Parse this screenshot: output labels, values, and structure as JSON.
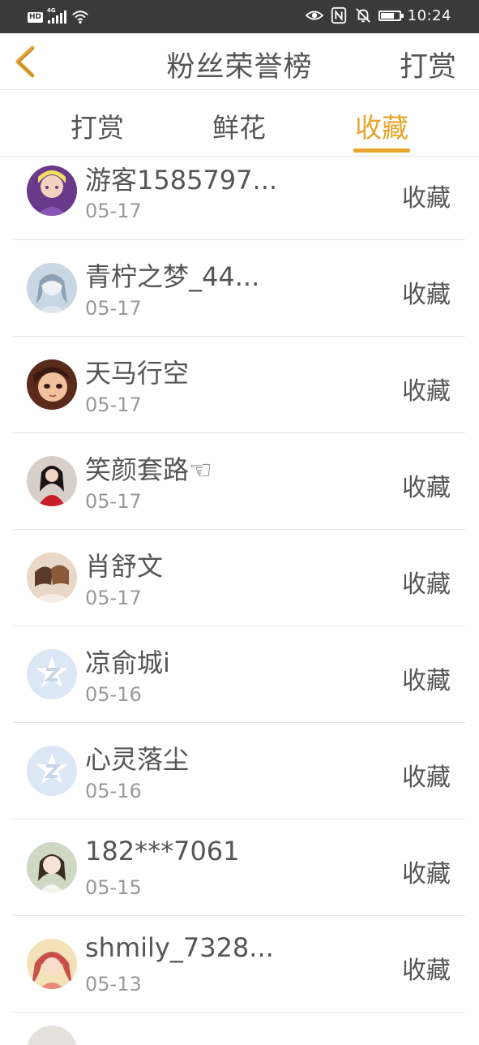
{
  "statusbar": {
    "left_badge": "HD",
    "network": "4G",
    "time": "10:24"
  },
  "header": {
    "title": "粉丝荣誉榜",
    "action": "打赏"
  },
  "tabs": [
    {
      "label": "打赏",
      "active": false
    },
    {
      "label": "鲜花",
      "active": false
    },
    {
      "label": "收藏",
      "active": true
    }
  ],
  "colors": {
    "accent": "#e7a52b",
    "text": "#555555",
    "subtext": "#999999",
    "divider": "#e6e6e6",
    "statusbar": "#3a3a3a"
  },
  "fans": [
    {
      "name": "游客1585797...",
      "date": "05-17",
      "action": "收藏"
    },
    {
      "name": "青柠之梦_44...",
      "date": "05-17",
      "action": "收藏"
    },
    {
      "name": "天马行空",
      "date": "05-17",
      "action": "收藏"
    },
    {
      "name": "笑颜套路☜",
      "date": "05-17",
      "action": "收藏"
    },
    {
      "name": "肖舒文",
      "date": "05-17",
      "action": "收藏"
    },
    {
      "name": "凉俞城i",
      "date": "05-16",
      "action": "收藏"
    },
    {
      "name": "心灵落尘",
      "date": "05-16",
      "action": "收藏"
    },
    {
      "name": "182***7061",
      "date": "05-15",
      "action": "收藏"
    },
    {
      "name": "shmily_7328...",
      "date": "05-13",
      "action": "收藏"
    }
  ]
}
